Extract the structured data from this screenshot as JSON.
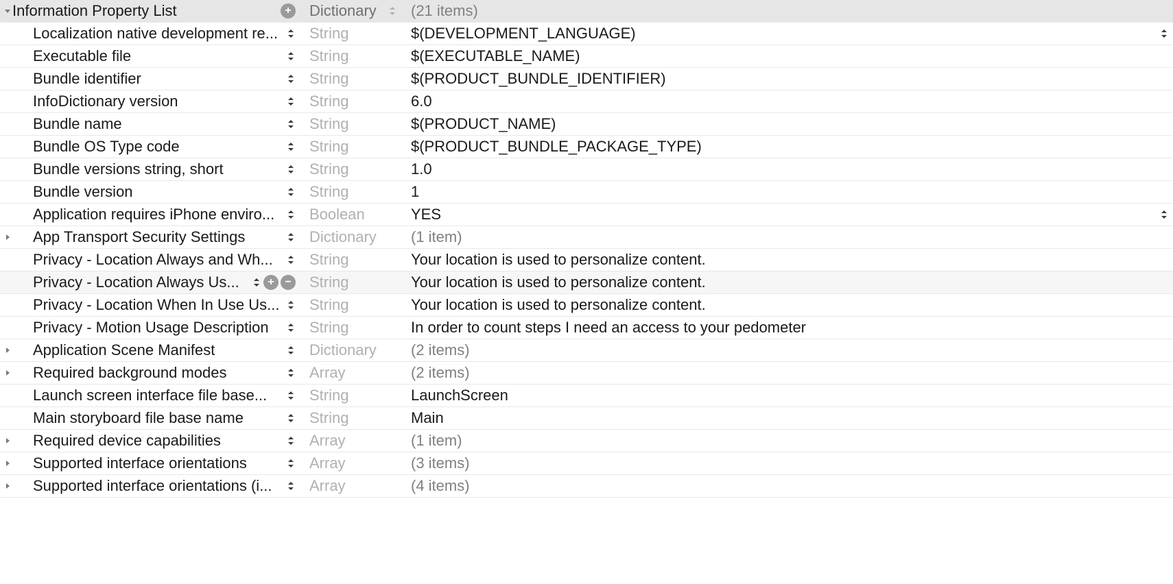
{
  "root": {
    "key": "Information Property List",
    "type": "Dictionary",
    "value": "(21 items)",
    "expanded": true
  },
  "rows": [
    {
      "key": "Localization native development re...",
      "type": "String",
      "value": "$(DEVELOPMENT_LANGUAGE)",
      "disclosure": "",
      "rightStep": true
    },
    {
      "key": "Executable file",
      "type": "String",
      "value": "$(EXECUTABLE_NAME)",
      "disclosure": ""
    },
    {
      "key": "Bundle identifier",
      "type": "String",
      "value": "$(PRODUCT_BUNDLE_IDENTIFIER)",
      "disclosure": ""
    },
    {
      "key": "InfoDictionary version",
      "type": "String",
      "value": "6.0",
      "disclosure": ""
    },
    {
      "key": "Bundle name",
      "type": "String",
      "value": "$(PRODUCT_NAME)",
      "disclosure": ""
    },
    {
      "key": "Bundle OS Type code",
      "type": "String",
      "value": "$(PRODUCT_BUNDLE_PACKAGE_TYPE)",
      "disclosure": ""
    },
    {
      "key": "Bundle versions string, short",
      "type": "String",
      "value": "1.0",
      "disclosure": ""
    },
    {
      "key": "Bundle version",
      "type": "String",
      "value": "1",
      "disclosure": ""
    },
    {
      "key": "Application requires iPhone enviro...",
      "type": "Boolean",
      "value": "YES",
      "disclosure": "",
      "rightStep": true
    },
    {
      "key": "App Transport Security Settings",
      "type": "Dictionary",
      "value": "(1 item)",
      "disclosure": "right",
      "muted": true
    },
    {
      "key": "Privacy - Location Always and Wh...",
      "type": "String",
      "value": "Your location is used to personalize content.",
      "disclosure": ""
    },
    {
      "key": "Privacy - Location Always Us...",
      "type": "String",
      "value": "Your location is used to personalize content.",
      "disclosure": "",
      "showAddRemove": true,
      "selected": true
    },
    {
      "key": "Privacy - Location When In Use Us...",
      "type": "String",
      "value": "Your location is used to personalize content.",
      "disclosure": ""
    },
    {
      "key": "Privacy - Motion Usage Description",
      "type": "String",
      "value": "In order to count steps I need an access to your pedometer",
      "disclosure": ""
    },
    {
      "key": "Application Scene Manifest",
      "type": "Dictionary",
      "value": "(2 items)",
      "disclosure": "right",
      "muted": true
    },
    {
      "key": "Required background modes",
      "type": "Array",
      "value": "(2 items)",
      "disclosure": "right",
      "muted": true
    },
    {
      "key": "Launch screen interface file base...",
      "type": "String",
      "value": "LaunchScreen",
      "disclosure": ""
    },
    {
      "key": "Main storyboard file base name",
      "type": "String",
      "value": "Main",
      "disclosure": ""
    },
    {
      "key": "Required device capabilities",
      "type": "Array",
      "value": "(1 item)",
      "disclosure": "right",
      "muted": true
    },
    {
      "key": "Supported interface orientations",
      "type": "Array",
      "value": "(3 items)",
      "disclosure": "right",
      "muted": true
    },
    {
      "key": "Supported interface orientations (i...",
      "type": "Array",
      "value": "(4 items)",
      "disclosure": "right",
      "muted": true
    }
  ]
}
